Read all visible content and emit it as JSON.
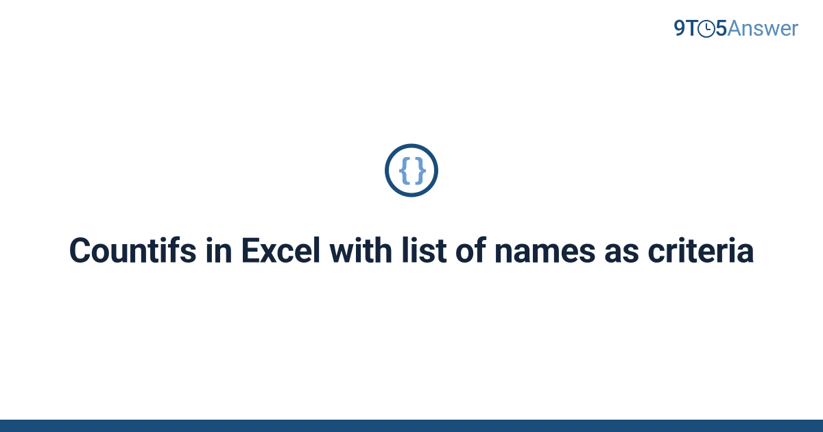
{
  "logo": {
    "part1": "9T",
    "part2": "5",
    "part3": "Answer"
  },
  "icon": {
    "glyph": "{ }",
    "name": "code-braces"
  },
  "title": "Countifs in Excel with list of names as criteria",
  "colors": {
    "primary": "#1a4d7a",
    "secondary": "#5b8db8",
    "accent": "#6a9dd4",
    "text": "#14243a"
  }
}
